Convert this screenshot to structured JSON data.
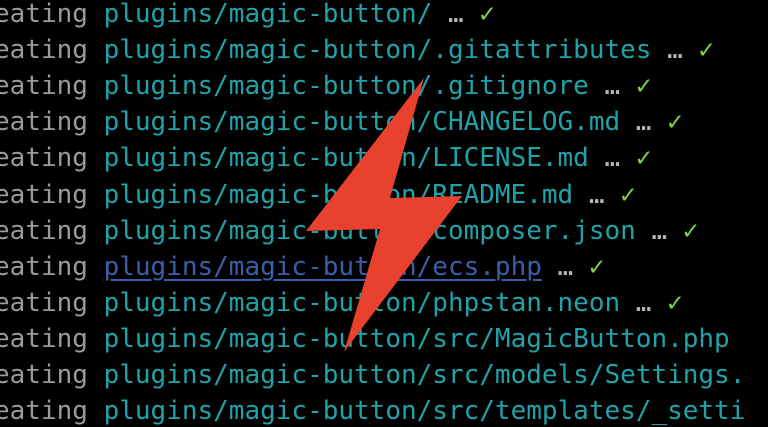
{
  "terminal": {
    "lines": [
      {
        "verb": "eating",
        "path": "plugins/magic-button/",
        "ellipsis": "…",
        "status": "✓",
        "link": false
      },
      {
        "verb": "eating",
        "path": "plugins/magic-button/.gitattributes",
        "ellipsis": "…",
        "status": "✓",
        "link": false
      },
      {
        "verb": "eating",
        "path": "plugins/magic-button/.gitignore",
        "ellipsis": "…",
        "status": "✓",
        "link": false
      },
      {
        "verb": "eating",
        "path": "plugins/magic-button/CHANGELOG.md",
        "ellipsis": "…",
        "status": "✓",
        "link": false
      },
      {
        "verb": "eating",
        "path": "plugins/magic-button/LICENSE.md",
        "ellipsis": "…",
        "status": "✓",
        "link": false
      },
      {
        "verb": "eating",
        "path": "plugins/magic-button/README.md",
        "ellipsis": "…",
        "status": "✓",
        "link": false
      },
      {
        "verb": "eating",
        "path": "plugins/magic-button/composer.json",
        "ellipsis": "…",
        "status": "✓",
        "link": false
      },
      {
        "verb": "eating",
        "path": "plugins/magic-button/ecs.php",
        "ellipsis": "…",
        "status": "✓",
        "link": true
      },
      {
        "verb": "eating",
        "path": "plugins/magic-button/phpstan.neon",
        "ellipsis": "…",
        "status": "✓",
        "link": false
      },
      {
        "verb": "eating",
        "path": "plugins/magic-button/src/MagicButton.php",
        "ellipsis": "",
        "status": "",
        "link": false
      },
      {
        "verb": "eating",
        "path": "plugins/magic-button/src/models/Settings.",
        "ellipsis": "",
        "status": "",
        "link": false
      },
      {
        "verb": "eating",
        "path": "plugins/magic-button/src/templates/_setti",
        "ellipsis": "",
        "status": "",
        "link": false
      }
    ]
  },
  "overlay": {
    "icon": "lightning-bolt-icon",
    "color": "#e8412e"
  },
  "colors": {
    "background": "#000000",
    "verb": "#9a9a9a",
    "path": "#1fa3a8",
    "link": "#3a5fa6",
    "check": "#7fd548"
  }
}
